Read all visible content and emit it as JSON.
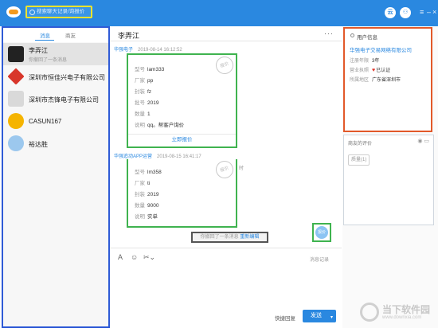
{
  "topbar": {
    "search_placeholder": "搜索聊天记录/询报价",
    "icon_cloud": "云",
    "icon_user": "⚇",
    "colors": {
      "bar": "#2a88e0"
    }
  },
  "left": {
    "tabs": [
      "消息",
      "商友"
    ],
    "contacts": [
      {
        "name": "李弄江",
        "sub": "你撤回了一条消息"
      },
      {
        "name": "深圳市恒佳兴电子有限公司"
      },
      {
        "name": "深圳市杰锋电子有限公司"
      },
      {
        "name": "CASUN167"
      },
      {
        "name": "裕达胜"
      }
    ]
  },
  "chat": {
    "title": "李弄江",
    "more": "···",
    "msg1": {
      "sender": "华强电子",
      "time": "2019-08-14 16:12:52"
    },
    "card1": {
      "stamp": "报价",
      "rows": [
        {
          "k": "型号",
          "v": "lam333"
        },
        {
          "k": "厂家",
          "v": "pp"
        },
        {
          "k": "封装",
          "v": "fz"
        },
        {
          "k": "批号",
          "v": "2019"
        },
        {
          "k": "数量",
          "v": "1"
        },
        {
          "k": "说明",
          "v": "qq。帮客户询价"
        }
      ],
      "action": "立即报价"
    },
    "msg2": {
      "sender": "华强追动APP运营",
      "time": "2019-08-15 16:41:17"
    },
    "card2": {
      "stamp": "报价",
      "rows": [
        {
          "k": "型号",
          "v": "lm358"
        },
        {
          "k": "厂家",
          "v": "ti"
        },
        {
          "k": "封装",
          "v": "2019"
        },
        {
          "k": "数量",
          "v": "9000"
        },
        {
          "k": "说明",
          "v": "实单"
        }
      ]
    },
    "edge_label": "时",
    "recall": {
      "text": "你撤回了一条消息",
      "link": "重新编辑"
    },
    "my_avatar": "报价",
    "toolbar": {
      "font": "A",
      "emoji": "☺",
      "scissors": "✂⌄"
    },
    "history": "消息记录",
    "quick_reply": "快捷回复",
    "send": "发送",
    "send_arrow": "▾"
  },
  "right": {
    "info_title": "用户信息",
    "company": "华强电子交易网络有限公司",
    "rows": [
      {
        "k": "注册年限",
        "v": "3年"
      },
      {
        "k": "营业执照",
        "v": "已认证"
      },
      {
        "k": "所属地区",
        "v": "广东省深圳市"
      }
    ],
    "eval_title": "商友的评价",
    "eval_tag": "质量(1)"
  },
  "watermark": {
    "line1": "当下软件园",
    "line2": "www.downxia.com"
  }
}
